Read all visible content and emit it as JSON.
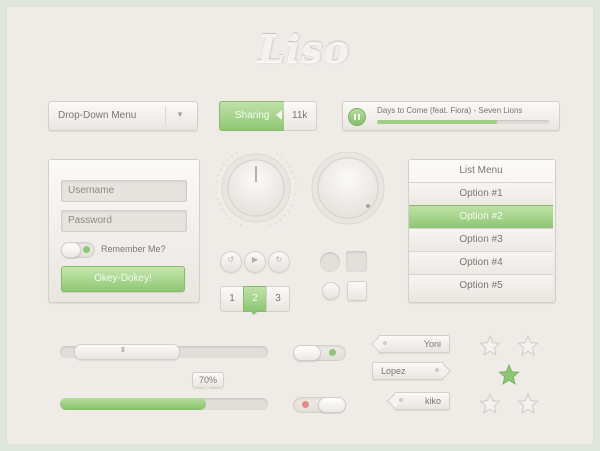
{
  "logo": {
    "text": "Liso"
  },
  "dropdown": {
    "label": "Drop-Down Menu",
    "arrow": "▼"
  },
  "share": {
    "label": "Sharing",
    "count": "11k"
  },
  "player": {
    "title": "Days to Come (feat. Fiora) - Seven Lions",
    "progress": 0.7
  },
  "login": {
    "username_placeholder": "Username",
    "password_placeholder": "Password",
    "remember_label": "Remember Me?",
    "submit_label": "Okey-Dokey!"
  },
  "media_controls": {
    "prev": "↺",
    "play": "▶",
    "next": "↻"
  },
  "pagination": {
    "pages": [
      "1",
      "2",
      "3"
    ],
    "selected": "2"
  },
  "list_menu": {
    "title": "List Menu",
    "options": [
      "Option #1",
      "Option #2",
      "Option #3",
      "Option #4",
      "Option #5"
    ],
    "selected": "Option #2"
  },
  "sliders": {
    "handle_grip": "III",
    "progress_label": "70%",
    "progress_value": 0.7
  },
  "tags": {
    "tag1": "Yoni",
    "tag2": "Lopez",
    "tag3": "kiko"
  },
  "stars": {
    "total": 5,
    "highlighted_index": 2
  },
  "colors": {
    "accent": "#8ec774",
    "accent_light": "#c4e6ad",
    "background": "#efece8",
    "frame": "#dfe6dc",
    "off_indicator": "#e58a86"
  }
}
